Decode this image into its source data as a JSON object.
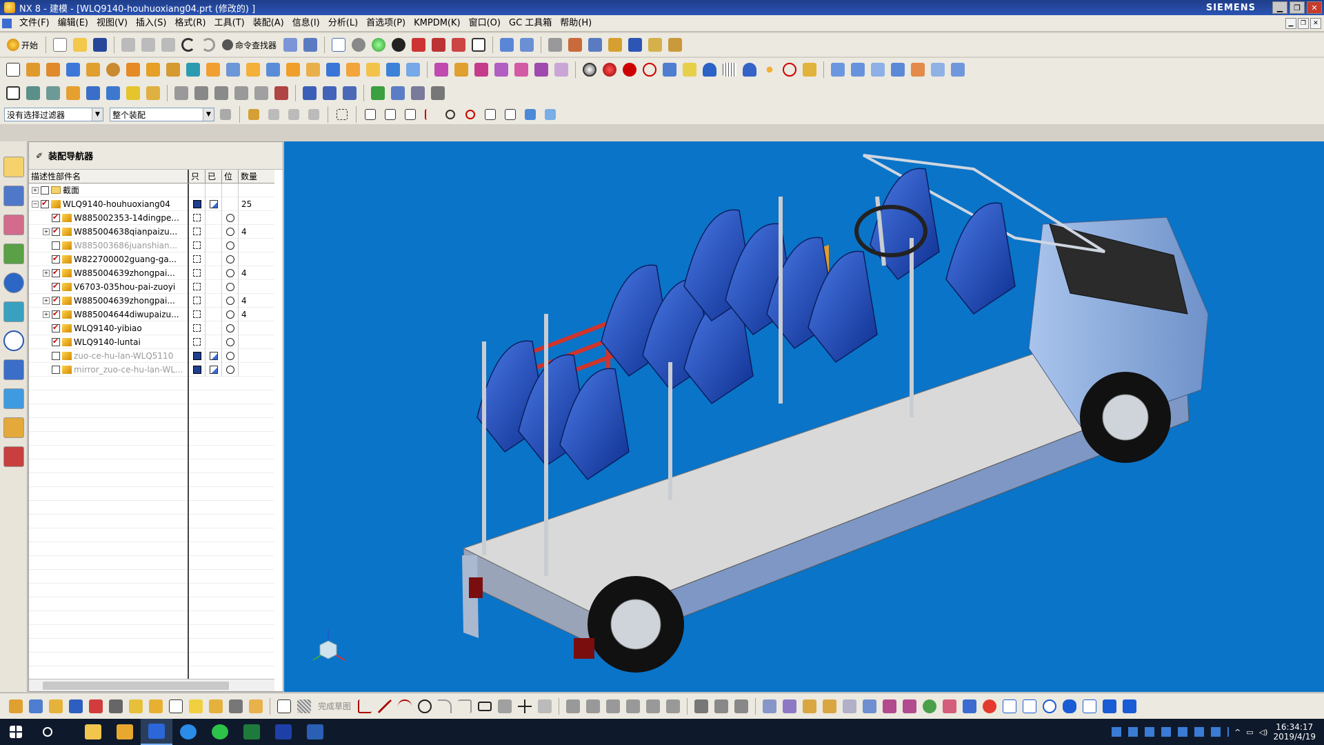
{
  "window": {
    "title": "NX 8 - 建模 - [WLQ9140-houhuoxiang04.prt  (修改的)  ]",
    "brand": "SIEMENS"
  },
  "menu": [
    "文件(F)",
    "编辑(E)",
    "视图(V)",
    "插入(S)",
    "格式(R)",
    "工具(T)",
    "装配(A)",
    "信息(I)",
    "分析(L)",
    "首选项(P)",
    "KMPDM(K)",
    "窗口(O)",
    "GC 工具箱",
    "帮助(H)"
  ],
  "toolbar": {
    "start_label": "开始",
    "command_finder": "命令查找器"
  },
  "selection": {
    "filter": "没有选择过滤器",
    "scope": "整个装配"
  },
  "bottom": {
    "finish_sketch": "完成草图"
  },
  "navigator": {
    "title": "装配导航器",
    "columns": [
      "描述性部件名",
      "只",
      "已",
      "位",
      "数量"
    ],
    "rows": [
      {
        "name": "截面",
        "indent": 0,
        "expand": "+",
        "type": "folder",
        "checked": false,
        "grey": false,
        "c1": "",
        "c2": "",
        "c3": "",
        "qty": ""
      },
      {
        "name": "WLQ9140-houhuoxiang04",
        "indent": 0,
        "expand": "−",
        "type": "asm",
        "checked": true,
        "grey": false,
        "c1": "save",
        "c2": "edit",
        "c3": "",
        "qty": "25"
      },
      {
        "name": "W885002353-14dingpe...",
        "indent": 1,
        "expand": "",
        "type": "part",
        "checked": true,
        "grey": false,
        "c1": "dash",
        "c2": "",
        "c3": "circ",
        "qty": ""
      },
      {
        "name": "W885004638qianpaizu...",
        "indent": 1,
        "expand": "+",
        "type": "asm",
        "checked": true,
        "grey": false,
        "c1": "dash",
        "c2": "",
        "c3": "circ",
        "qty": "4"
      },
      {
        "name": "W885003686juanshian...",
        "indent": 1,
        "expand": "",
        "type": "part",
        "checked": false,
        "grey": true,
        "c1": "dash",
        "c2": "",
        "c3": "circ",
        "qty": ""
      },
      {
        "name": "W822700002guang-ga...",
        "indent": 1,
        "expand": "",
        "type": "part",
        "checked": true,
        "grey": false,
        "c1": "dash",
        "c2": "",
        "c3": "circ",
        "qty": ""
      },
      {
        "name": "W885004639zhongpai...",
        "indent": 1,
        "expand": "+",
        "type": "asm",
        "checked": true,
        "grey": false,
        "c1": "dash",
        "c2": "",
        "c3": "circ",
        "qty": "4"
      },
      {
        "name": "V6703-035hou-pai-zuoyi",
        "indent": 1,
        "expand": "",
        "type": "part",
        "checked": true,
        "grey": false,
        "c1": "dash",
        "c2": "",
        "c3": "circ",
        "qty": ""
      },
      {
        "name": "W885004639zhongpai...",
        "indent": 1,
        "expand": "+",
        "type": "asm",
        "checked": true,
        "grey": false,
        "c1": "dash",
        "c2": "",
        "c3": "circ",
        "qty": "4"
      },
      {
        "name": "W885004644diwupaizu...",
        "indent": 1,
        "expand": "+",
        "type": "asm",
        "checked": true,
        "grey": false,
        "c1": "dash",
        "c2": "",
        "c3": "circ",
        "qty": "4"
      },
      {
        "name": "WLQ9140-yibiao",
        "indent": 1,
        "expand": "",
        "type": "part",
        "checked": true,
        "grey": false,
        "c1": "dash",
        "c2": "",
        "c3": "circ",
        "qty": ""
      },
      {
        "name": "WLQ9140-luntai",
        "indent": 1,
        "expand": "",
        "type": "part",
        "checked": true,
        "grey": false,
        "c1": "dash",
        "c2": "",
        "c3": "circ",
        "qty": ""
      },
      {
        "name": "zuo-ce-hu-lan-WLQ5110",
        "indent": 1,
        "expand": "",
        "type": "part",
        "checked": false,
        "grey": true,
        "c1": "save",
        "c2": "edit",
        "c3": "circ",
        "qty": ""
      },
      {
        "name": "mirror_zuo-ce-hu-lan-WL...",
        "indent": 1,
        "expand": "",
        "type": "part",
        "checked": false,
        "grey": true,
        "c1": "save",
        "c2": "edit",
        "c3": "circ",
        "qty": ""
      }
    ]
  },
  "taskbar": {
    "time": "16:34:17",
    "date": "2019/4/19"
  },
  "colors": {
    "viewport": "#0a74c8",
    "seat": "#1f4fc2",
    "rail": "#d0342c"
  }
}
